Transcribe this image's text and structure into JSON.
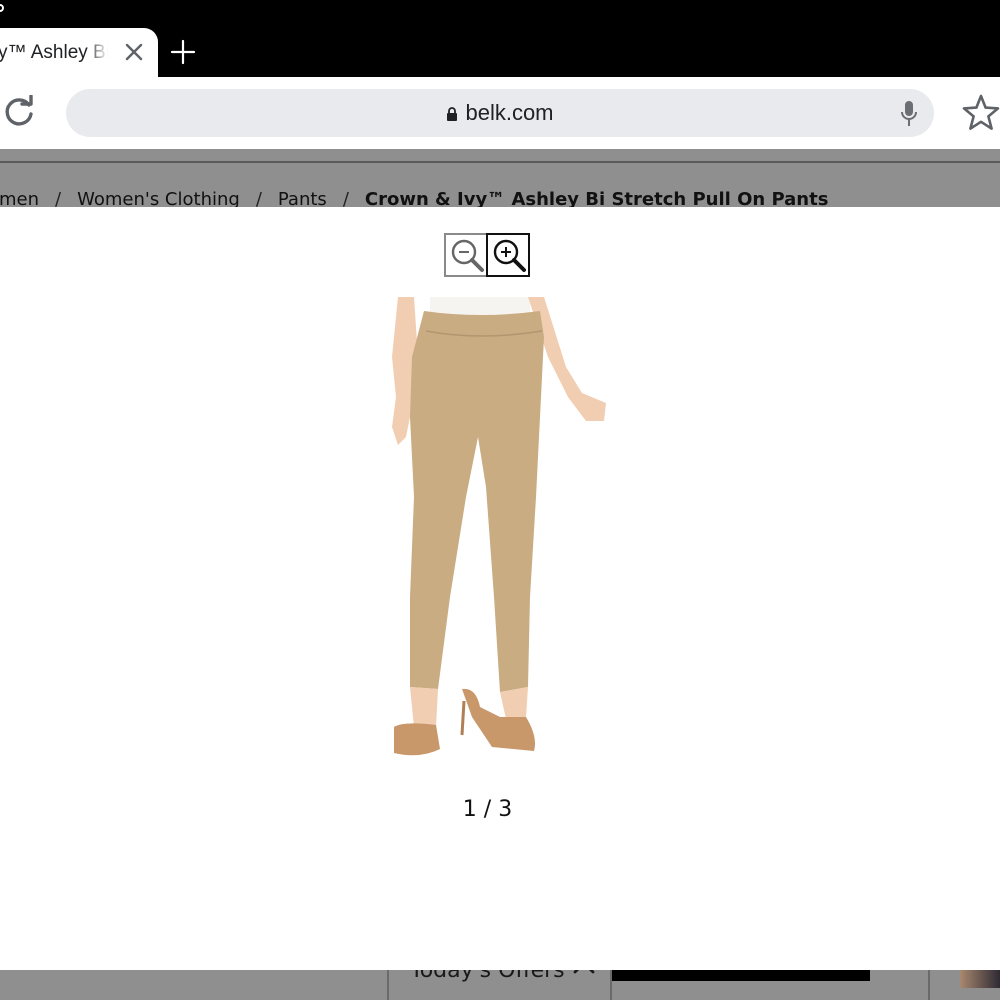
{
  "browser": {
    "tab": {
      "title": "y™ Ashley Bi S",
      "close_icon": "close-icon"
    },
    "new_tab_icon": "plus-icon",
    "reload_icon": "reload-icon",
    "address_bar": {
      "url": "belk.com",
      "lock_icon": "lock-icon",
      "mic_icon": "mic-icon"
    },
    "bookmark_icon": "star-icon"
  },
  "breadcrumb": {
    "items": [
      "omen",
      "Women's Clothing",
      "Pants"
    ],
    "separator": "/",
    "current": "Crown & Ivy™ Ashley Bi Stretch Pull On Pants"
  },
  "zoom_modal": {
    "zoom_out_icon": "zoom-out-icon",
    "zoom_in_icon": "zoom-in-icon",
    "image_counter": "1 / 3",
    "product_colors": {
      "pants": "#c9ac82",
      "top": "#f6f4f0",
      "skin": "#f1cdb2",
      "shoes": "#c8976a"
    }
  },
  "bottom_bar": {
    "offers_label": "Today's Offers",
    "chevron_icon": "chevron-up-icon"
  }
}
